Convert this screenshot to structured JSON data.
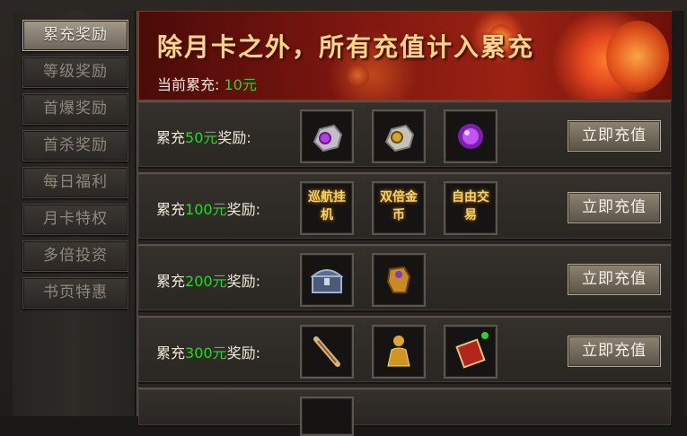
{
  "sidebar": {
    "tabs": [
      {
        "label": "累充奖励",
        "active": true
      },
      {
        "label": "等级奖励"
      },
      {
        "label": "首爆奖励"
      },
      {
        "label": "首杀奖励"
      },
      {
        "label": "每日福利"
      },
      {
        "label": "月卡特权"
      },
      {
        "label": "多倍投资"
      },
      {
        "label": "书页特惠"
      }
    ]
  },
  "banner": {
    "title": "除月卡之外，所有充值计入累充",
    "current_prefix": "当前累充:",
    "current_value": "10元"
  },
  "rewards": [
    {
      "prefix": "累充",
      "amount": "50元",
      "suffix": "奖励:",
      "items": [
        {
          "icon": "purple-gem-stone-icon"
        },
        {
          "icon": "gold-gem-stone-icon"
        },
        {
          "icon": "purple-orb-icon"
        }
      ],
      "button": "立即充值"
    },
    {
      "prefix": "累充",
      "amount": "100元",
      "suffix": "奖励:",
      "items": [
        {
          "icon": "text-icon",
          "text": "巡航挂机"
        },
        {
          "icon": "text-icon",
          "text": "双倍金币"
        },
        {
          "icon": "text-icon",
          "text": "自由交易"
        }
      ],
      "button": "立即充值"
    },
    {
      "prefix": "累充",
      "amount": "200元",
      "suffix": "奖励:",
      "items": [
        {
          "icon": "treasure-chest-icon"
        },
        {
          "icon": "gold-gauntlet-icon"
        }
      ],
      "button": "立即充值"
    },
    {
      "prefix": "累充",
      "amount": "300元",
      "suffix": "奖励:",
      "items": [
        {
          "icon": "scroll-sword-icon"
        },
        {
          "icon": "golden-figure-icon"
        },
        {
          "icon": "red-book-icon",
          "badge": true
        }
      ],
      "button": "立即充值"
    }
  ],
  "colors": {
    "accent_green": "#25d624",
    "banner_title": "#ffd58a"
  }
}
